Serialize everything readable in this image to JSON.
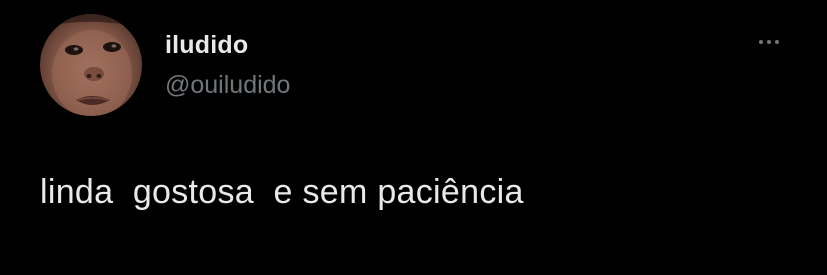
{
  "author": {
    "display_name": "iludido",
    "handle": "@ouiludido",
    "avatar_icon": "profile-photo"
  },
  "actions": {
    "more_icon": "more-horizontal-icon"
  },
  "tweet": {
    "text": "linda  gostosa  e sem paciência"
  },
  "colors": {
    "background": "#000000",
    "primary_text": "#e7e9ea",
    "secondary_text": "#71767b"
  }
}
